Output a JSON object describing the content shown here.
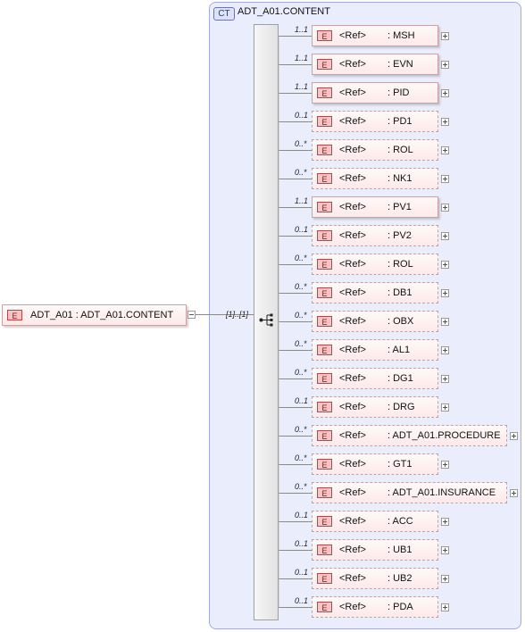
{
  "root": {
    "badge": "E",
    "label": "ADT_A01 : ADT_A01.CONTENT",
    "cardinality": "[1]..[1]"
  },
  "complex_type": {
    "badge": "CT",
    "title": "ADT_A01.CONTENT"
  },
  "elements": [
    {
      "badge": "E",
      "ref": "<Ref>",
      "name": ": MSH",
      "card": "1..1",
      "optional": false
    },
    {
      "badge": "E",
      "ref": "<Ref>",
      "name": ": EVN",
      "card": "1..1",
      "optional": false
    },
    {
      "badge": "E",
      "ref": "<Ref>",
      "name": ": PID",
      "card": "1..1",
      "optional": false
    },
    {
      "badge": "E",
      "ref": "<Ref>",
      "name": ": PD1",
      "card": "0..1",
      "optional": true
    },
    {
      "badge": "E",
      "ref": "<Ref>",
      "name": ": ROL",
      "card": "0..*",
      "optional": true
    },
    {
      "badge": "E",
      "ref": "<Ref>",
      "name": ": NK1",
      "card": "0..*",
      "optional": true
    },
    {
      "badge": "E",
      "ref": "<Ref>",
      "name": ": PV1",
      "card": "1..1",
      "optional": false
    },
    {
      "badge": "E",
      "ref": "<Ref>",
      "name": ": PV2",
      "card": "0..1",
      "optional": true
    },
    {
      "badge": "E",
      "ref": "<Ref>",
      "name": ": ROL",
      "card": "0..*",
      "optional": true
    },
    {
      "badge": "E",
      "ref": "<Ref>",
      "name": ": DB1",
      "card": "0..*",
      "optional": true
    },
    {
      "badge": "E",
      "ref": "<Ref>",
      "name": ": OBX",
      "card": "0..*",
      "optional": true
    },
    {
      "badge": "E",
      "ref": "<Ref>",
      "name": ": AL1",
      "card": "0..*",
      "optional": true
    },
    {
      "badge": "E",
      "ref": "<Ref>",
      "name": ": DG1",
      "card": "0..*",
      "optional": true
    },
    {
      "badge": "E",
      "ref": "<Ref>",
      "name": ": DRG",
      "card": "0..1",
      "optional": true
    },
    {
      "badge": "E",
      "ref": "<Ref>",
      "name": ": ADT_A01.PROCEDURE",
      "card": "0..*",
      "optional": true
    },
    {
      "badge": "E",
      "ref": "<Ref>",
      "name": ": GT1",
      "card": "0..*",
      "optional": true
    },
    {
      "badge": "E",
      "ref": "<Ref>",
      "name": ": ADT_A01.INSURANCE",
      "card": "0..*",
      "optional": true
    },
    {
      "badge": "E",
      "ref": "<Ref>",
      "name": ": ACC",
      "card": "0..1",
      "optional": true
    },
    {
      "badge": "E",
      "ref": "<Ref>",
      "name": ": UB1",
      "card": "0..1",
      "optional": true
    },
    {
      "badge": "E",
      "ref": "<Ref>",
      "name": ": UB2",
      "card": "0..1",
      "optional": true
    },
    {
      "badge": "E",
      "ref": "<Ref>",
      "name": ": PDA",
      "card": "0..1",
      "optional": true
    }
  ]
}
